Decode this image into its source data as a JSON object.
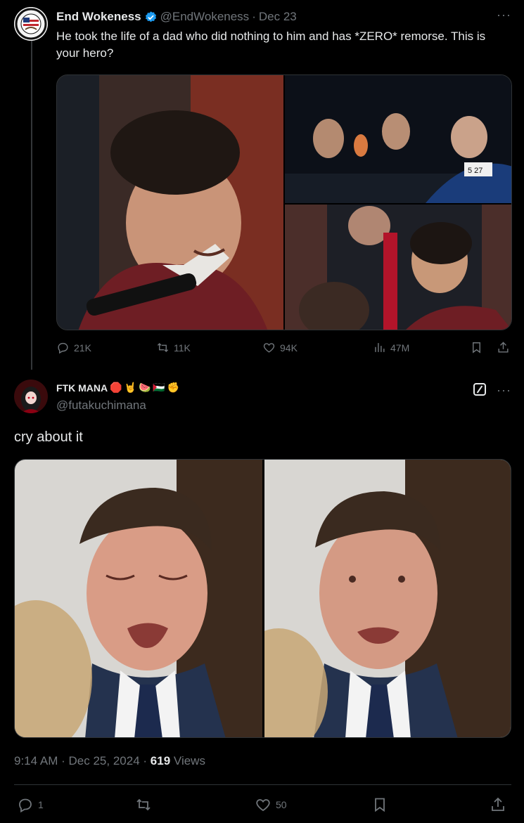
{
  "parent": {
    "avatar_text": "SUPPORT ICE",
    "name": "End Wokeness",
    "handle": "@EndWokeness",
    "separator": "·",
    "date": "Dec 23",
    "more": "···",
    "text": "He took the life of a dad who did nothing to him and has *ZERO* remorse. This is your hero?",
    "media_plate": "5 27",
    "actions": {
      "replies": "21K",
      "retweets": "11K",
      "likes": "94K",
      "views": "47M"
    }
  },
  "main": {
    "name": "FTK MANA",
    "name_emojis": [
      "🛑",
      "🤘",
      "🍉",
      "🇵🇸",
      "✊"
    ],
    "handle": "@futakuchimana",
    "more": "···",
    "text": "cry about it",
    "meta": {
      "time": "9:14 AM",
      "separator": "·",
      "date": "Dec 25, 2024",
      "separator2": "·",
      "views_count": "619",
      "views_label": "Views"
    },
    "actions": {
      "replies": "1",
      "likes": "50"
    }
  },
  "colors": {
    "background": "#000000",
    "text": "#e7e9ea",
    "muted": "#71767b",
    "border": "#2f3336",
    "verified": "#1d9bf0"
  }
}
